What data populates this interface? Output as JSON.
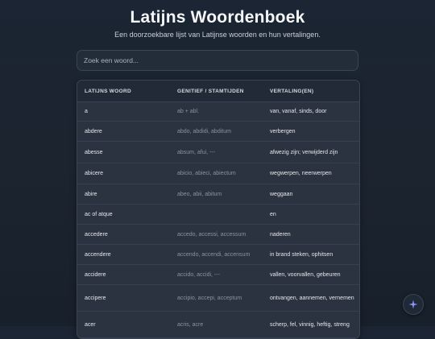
{
  "header": {
    "title": "Latijns Woordenboek",
    "subtitle": "Een doorzoekbare lijst van Latijnse woorden en hun vertalingen."
  },
  "search": {
    "placeholder": "Zoek een woord...",
    "value": ""
  },
  "table": {
    "columns": [
      "LATIJNS WOORD",
      "GENITIEF / STAMTIJDEN",
      "VERTALING(EN)"
    ],
    "rows": [
      {
        "word": "a",
        "forms": "ab + abl.",
        "translation": "van, vanaf, sinds, door"
      },
      {
        "word": "abdere",
        "forms": "abdo, abdidi, abditum",
        "translation": "verbergen"
      },
      {
        "word": "abesse",
        "forms": "absum, afui, ---",
        "translation": "afwezig zijn; verwijderd zijn"
      },
      {
        "word": "abicere",
        "forms": "abicio, abieci, abiectum",
        "translation": "wegwerpen, neerwerpen"
      },
      {
        "word": "abire",
        "forms": "abeo, abii, abitum",
        "translation": "weggaan"
      },
      {
        "word": "ac of atque",
        "forms": "",
        "translation": "en"
      },
      {
        "word": "accedere",
        "forms": "accedo, accessi, accessum",
        "translation": "naderen"
      },
      {
        "word": "accendere",
        "forms": "accendo, accendi, accensum",
        "translation": "in brand steken, ophitsen"
      },
      {
        "word": "accidere",
        "forms": "accido, accidi, ---",
        "translation": "vallen, voorvallen, gebeuren"
      },
      {
        "word": "accipere",
        "forms": "accipio, accepi, acceptum",
        "translation": "ontvangen, aannemen, vernemen"
      },
      {
        "word": "acer",
        "forms": "acris, acre",
        "translation": "scherp, fel, vinnig, heftig, streng"
      }
    ]
  },
  "colors": {
    "background": "#1c2430",
    "panel": "#2b3340",
    "accent": "#8b7cf6"
  },
  "icons": {
    "fab": "sparkle-icon"
  }
}
